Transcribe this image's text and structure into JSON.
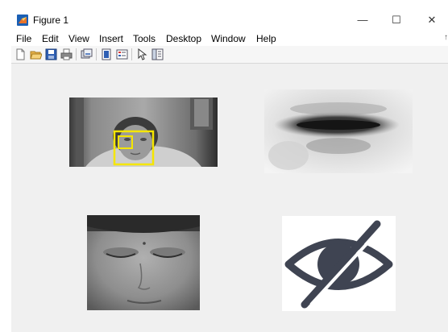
{
  "window": {
    "title": "Figure 1",
    "controls": {
      "minimize": "—",
      "maximize": "☐",
      "close": "✕"
    }
  },
  "menubar": {
    "items": [
      "File",
      "Edit",
      "View",
      "Insert",
      "Tools",
      "Desktop",
      "Window",
      "Help"
    ],
    "overflow_arrow": "↑"
  },
  "toolbar": {
    "buttons": [
      "new-figure-icon",
      "open-file-icon",
      "save-icon",
      "print-icon",
      "link-plot-icon",
      "insert-colorbar-icon",
      "insert-legend-icon",
      "edit-plot-pointer-icon",
      "property-inspector-icon"
    ]
  },
  "axes": [
    {
      "content": "face-detection-frame",
      "overlay_color": "#f5e600"
    },
    {
      "content": "mouth-region-crop"
    },
    {
      "content": "closed-eyes-face"
    },
    {
      "content": "eye-closed-icon",
      "icon_color": "#3f4452"
    }
  ],
  "colors": {
    "detection_box": "#f5e600",
    "icon": "#3f4452",
    "window_bg": "#f0f0f0"
  }
}
